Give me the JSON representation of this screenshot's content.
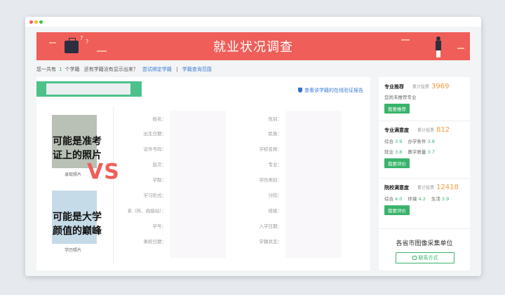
{
  "page": {
    "title": "就业状况调查"
  },
  "infobar": {
    "prefix": "您一共有",
    "count": "1",
    "suffix": "个学籍",
    "question": "还有学籍没有显示出来？",
    "link1": "尝试绑定学籍",
    "sep": "|",
    "link2": "学籍查询范围"
  },
  "main": {
    "verify_link": "查看该学籍的在线验证报告",
    "photo1_caption": "录取照片",
    "photo2_caption": "学历照片",
    "overlay_top": "可能是准考\n证上的照片",
    "vs": "VS",
    "overlay_bottom": "可能是大学\n颜值的巅峰",
    "left_labels": [
      "姓名：",
      "出生日期：",
      "证件号码：",
      "层次：",
      "学制：",
      "学习形式：",
      "系（所、函授站）：",
      "学号：",
      "离校日期："
    ],
    "right_labels": [
      "性别：",
      "民族：",
      "学校名称：",
      "专业：",
      "学历类别：",
      "分院：",
      "班级：",
      "入学日期：",
      "学籍状态："
    ]
  },
  "sidebar": {
    "major_recommend": {
      "title": "专业推荐",
      "total_label": "累计投票",
      "total": "3969",
      "note": "您尚未推荐专业",
      "button": "我要推荐"
    },
    "major_satisfaction": {
      "title": "专业满意度",
      "total_label": "累计投票",
      "total": "812",
      "ratings": [
        [
          "综合",
          "3.9"
        ],
        [
          "办学条件",
          "3.8"
        ],
        [
          "就业",
          "3.8"
        ],
        [
          "教学质量",
          "3.7"
        ]
      ],
      "button": "我要评价"
    },
    "school_satisfaction": {
      "title": "院校满意度",
      "total_label": "累计投票",
      "total": "12418",
      "ratings": [
        [
          "综合",
          "4.0"
        ],
        [
          "环境",
          "4.2"
        ],
        [
          "生活",
          "3.9"
        ]
      ],
      "button": "我要评价"
    },
    "unit": "各省市图像采集单位",
    "contact": "联系方式"
  },
  "colors": {
    "banner": "#ef5e58",
    "green": "#39b36b",
    "accent_orange": "#f39a3c",
    "link": "#3a7bd5"
  }
}
